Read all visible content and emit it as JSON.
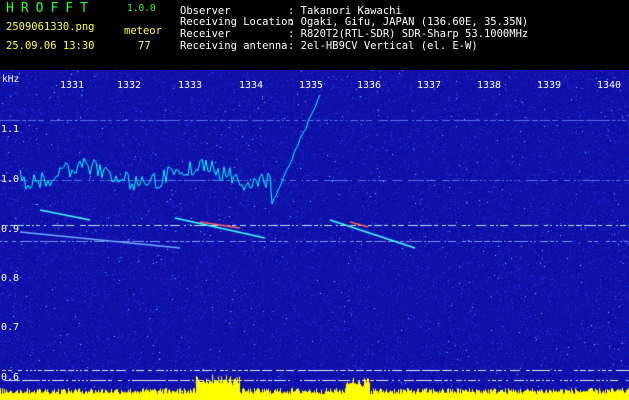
{
  "app": {
    "name": "HROFFT",
    "version": "1.0.0"
  },
  "info": {
    "filename": "2509061330.png",
    "timestamp": "25.09.06 13:30",
    "meteor_label": "meteor",
    "meteor_count": "77"
  },
  "observer": {
    "rows": [
      {
        "label": "Observer",
        "value": ": Takanori Kawachi"
      },
      {
        "label": "Receiving Location",
        "value": ": Ogaki, Gifu, JAPAN (136.60E, 35.35N)"
      },
      {
        "label": "Receiver",
        "value": ": R820T2(RTL-SDR) SDR-Sharp 53.1000MHz"
      },
      {
        "label": "Receiving antenna",
        "value": ": 2el-HB9CV Vertical (el. E-W)"
      }
    ]
  },
  "colors": {
    "background": "#1010a8",
    "accent": "#2fff2f",
    "trace": "#00ffff",
    "histogram": "#ffff00"
  },
  "spectrogram": {
    "unit_label": "kHz",
    "y_ticks": [
      "1.1",
      "1.0",
      "0.9",
      "0.8",
      "0.7",
      "0.6"
    ],
    "x_ticks": [
      "1331",
      "1332",
      "1333",
      "1334",
      "1335",
      "1336",
      "1337",
      "1338",
      "1339",
      "1340"
    ]
  }
}
